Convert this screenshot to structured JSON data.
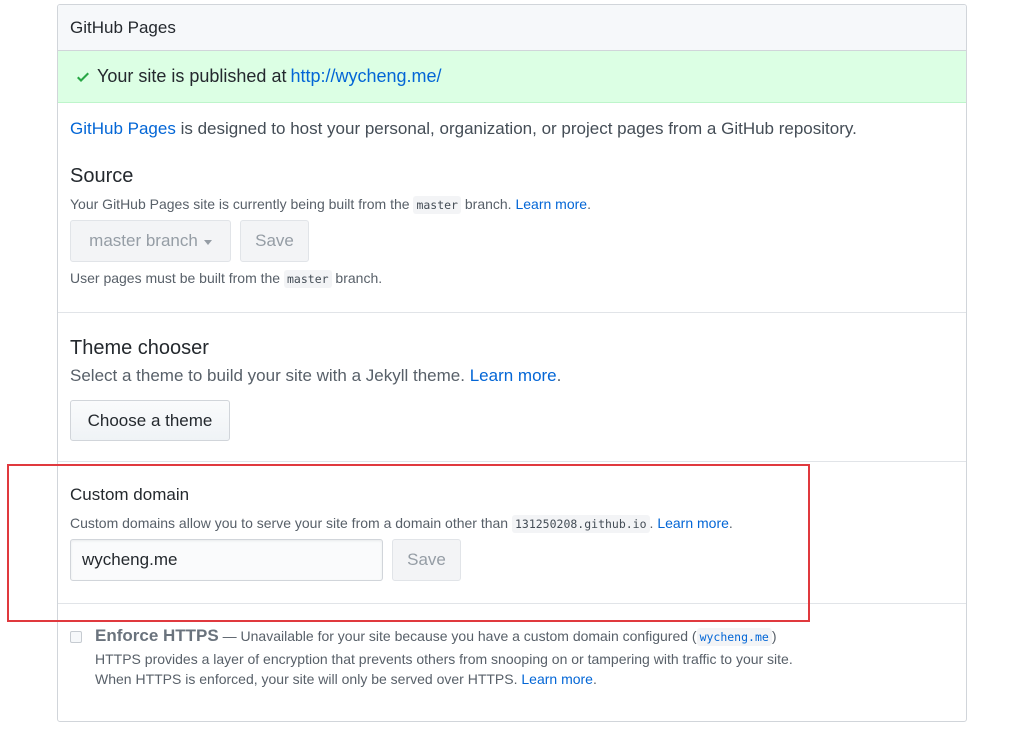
{
  "header": {
    "title": "GitHub Pages"
  },
  "flash": {
    "icon": "check-icon",
    "text_prefix": "Your site is published at ",
    "url": "http://wycheng.me/"
  },
  "intro": {
    "link": "GitHub Pages",
    "text": " is designed to host your personal, organization, or project pages from a GitHub repository."
  },
  "source": {
    "heading": "Source",
    "desc_prefix": "Your GitHub Pages site is currently being built from the ",
    "desc_code": "master",
    "desc_suffix": " branch. ",
    "learn_more": "Learn more",
    "learn_more_suffix": ".",
    "branch_select": "master branch",
    "save_label": "Save",
    "note_prefix": "User pages must be built from the ",
    "note_code": "master",
    "note_suffix": " branch."
  },
  "theme": {
    "heading": "Theme chooser",
    "desc": "Select a theme to build your site with a Jekyll theme. ",
    "learn_more": "Learn more",
    "learn_more_suffix": ".",
    "button_label": "Choose a theme"
  },
  "custom_domain": {
    "heading": "Custom domain",
    "desc_prefix": "Custom domains allow you to serve your site from a domain other than ",
    "desc_code": "131250208.github.io",
    "desc_suffix": ". ",
    "learn_more": "Learn more",
    "learn_more_suffix": ".",
    "input_value": "wycheng.me",
    "save_label": "Save"
  },
  "https": {
    "title": "Enforce HTTPS",
    "dash_text": " — Unavailable for your site because you have a custom domain configured (",
    "code": "wycheng.me",
    "close_paren": ")",
    "line2": "HTTPS provides a layer of encryption that prevents others from snooping on or tampering with traffic to your site.",
    "line3": "When HTTPS is enforced, your site will only be served over HTTPS. ",
    "learn_more": "Learn more",
    "learn_more_suffix": "."
  },
  "colors": {
    "link": "#0366d6",
    "flash_bg": "#dcffe4",
    "check": "#28a745",
    "highlight": "#e0393e"
  }
}
